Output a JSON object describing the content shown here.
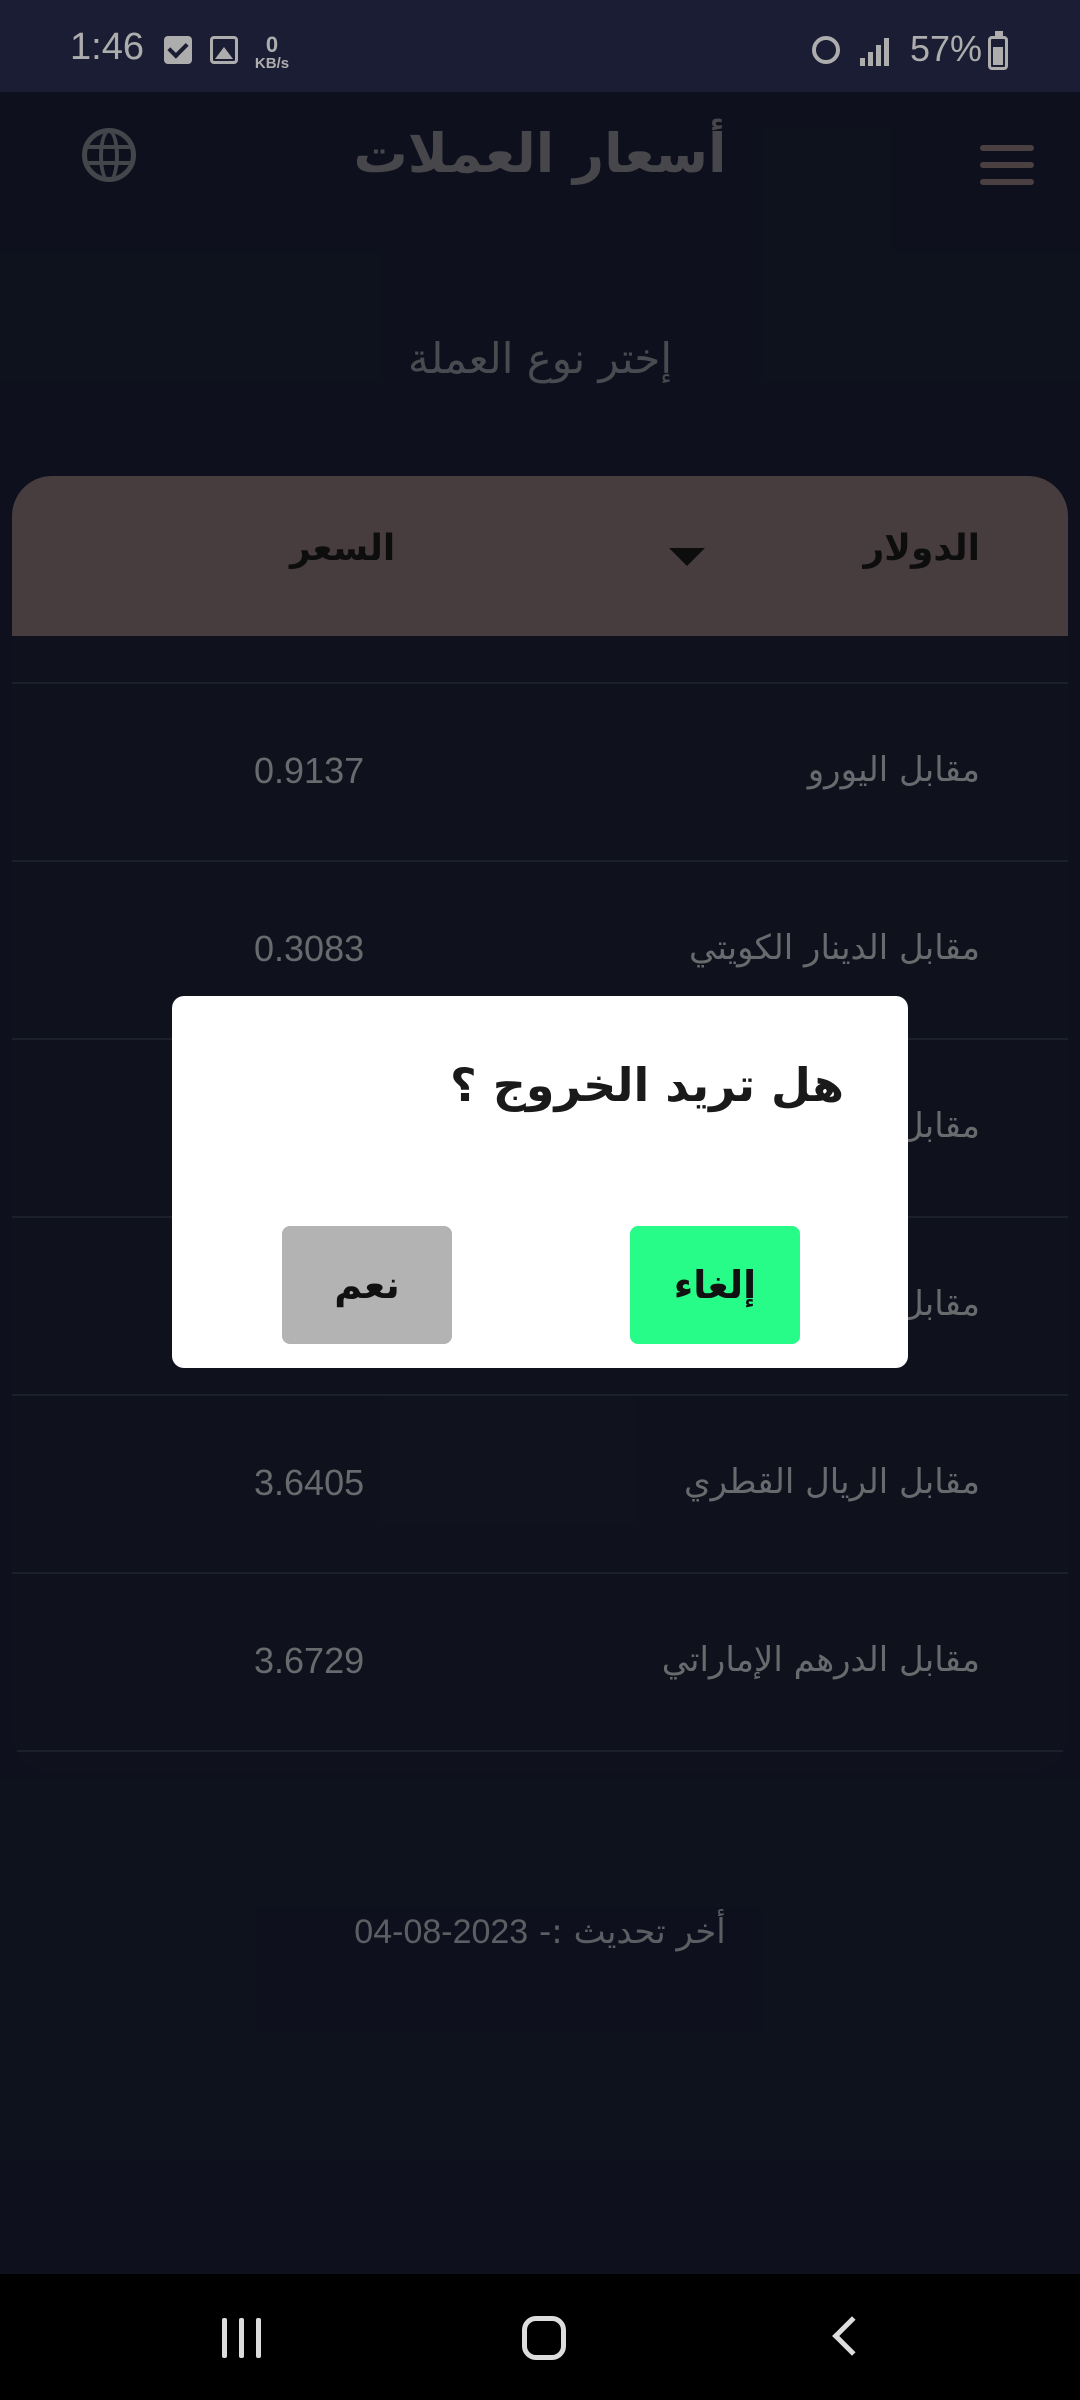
{
  "status_bar": {
    "time": "1:46",
    "net_speed_value": "0",
    "net_speed_unit": "KB/s",
    "battery": "57%"
  },
  "header": {
    "title": "أسعار العملات"
  },
  "prompt": "إختر نوع العملة",
  "table": {
    "selected_currency": "الدولار",
    "price_header": "السعر",
    "rows": [
      {
        "label": "مقابل اليورو",
        "value": "0.9137"
      },
      {
        "label": "مقابل الدينار الكويتي",
        "value": "0.3083"
      },
      {
        "label": "مقابل",
        "value": ""
      },
      {
        "label": "مقابل",
        "value": ""
      },
      {
        "label": "مقابل  الريال القطري",
        "value": "3.6405"
      },
      {
        "label": "مقابل  الدرهم الإماراتي",
        "value": "3.6729"
      }
    ]
  },
  "footer": {
    "updated_label": "أخر تحديث  :-",
    "updated_date": "04-08-2023"
  },
  "dialog": {
    "title": "هل تريد الخروج ؟",
    "cancel_label": "إلغاء",
    "yes_label": "نعم"
  },
  "colors": {
    "accent_green": "#26fc87",
    "header_row": "#6a5a5c",
    "background": "#151a2b"
  }
}
